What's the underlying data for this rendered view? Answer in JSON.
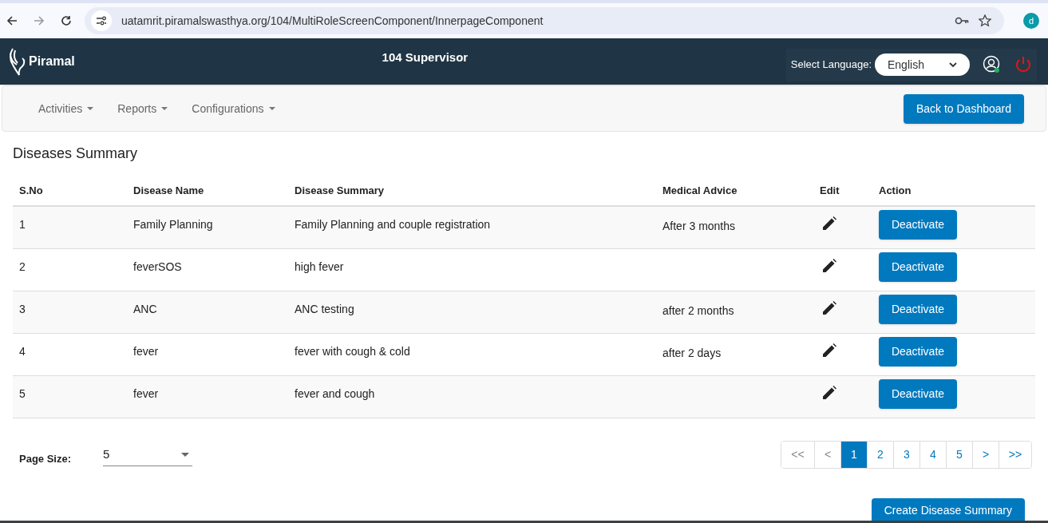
{
  "browser": {
    "url": "uatamrit.piramalswasthya.org/104/MultiRoleScreenComponent/InnerpageComponent",
    "profile": "d"
  },
  "header": {
    "logo": "Piramal",
    "title": "104 Supervisor",
    "language_label": "Select Language:",
    "language": "English"
  },
  "nav": {
    "menus": [
      "Activities",
      "Reports",
      "Configurations"
    ],
    "back_button": "Back to Dashboard"
  },
  "page_title": "Diseases Summary",
  "table": {
    "columns": [
      "S.No",
      "Disease Name",
      "Disease Summary",
      "Medical Advice",
      "Edit",
      "Action"
    ],
    "rows": [
      {
        "sno": "1",
        "name": "Family Planning",
        "summary": "Family Planning and couple registration",
        "advice": "After 3 months",
        "action": "Deactivate"
      },
      {
        "sno": "2",
        "name": "feverSOS",
        "summary": "high fever",
        "action": "Deactivate"
      },
      {
        "sno": "3",
        "name": "ANC",
        "summary": "ANC testing",
        "advice": "after 2 months",
        "action": "Deactivate"
      },
      {
        "sno": "4",
        "name": "fever",
        "summary": "fever with cough & cold",
        "advice": "after 2 days",
        "action": "Deactivate"
      },
      {
        "sno": "5",
        "name": "fever",
        "summary": "fever and cough",
        "action": "Deactivate"
      }
    ]
  },
  "page_size": {
    "label": "Page Size:",
    "value": "5"
  },
  "pagination": [
    {
      "label": "<<",
      "selected": false,
      "disabled": true
    },
    {
      "label": "<",
      "selected": false,
      "disabled": true
    },
    {
      "label": "1",
      "selected": true,
      "disabled": false
    },
    {
      "label": "2",
      "selected": false,
      "disabled": false
    },
    {
      "label": "3",
      "selected": false,
      "disabled": false
    },
    {
      "label": "4",
      "selected": false,
      "disabled": false
    },
    {
      "label": "5",
      "selected": false,
      "disabled": false
    },
    {
      "label": ">",
      "selected": false,
      "disabled": false
    },
    {
      "label": ">>",
      "selected": false,
      "disabled": false
    }
  ],
  "create_button": "Create Disease Summary"
}
